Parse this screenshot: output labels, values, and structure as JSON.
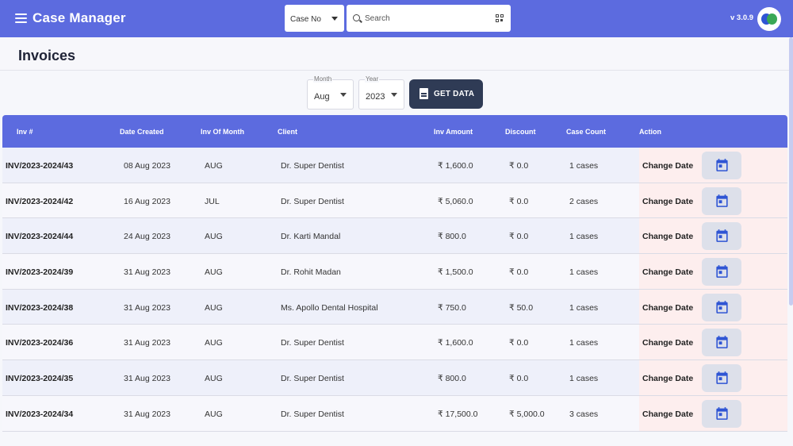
{
  "app": {
    "title": "Case Manager",
    "version": "v 3.0.9"
  },
  "search": {
    "type_label": "Case No",
    "placeholder": "Search"
  },
  "page": {
    "title": "Invoices"
  },
  "filters": {
    "month": {
      "label": "Month",
      "value": "Aug"
    },
    "year": {
      "label": "Year",
      "value": "2023"
    },
    "get_data_label": "GET DATA"
  },
  "table": {
    "headers": [
      "Inv #",
      "Date Created",
      "Inv Of Month",
      "Client",
      "Inv Amount",
      "Discount",
      "Case Count",
      "Action"
    ],
    "action_label": "Change Date",
    "rows": [
      {
        "inv": "INV/2023-2024/43",
        "date": "08 Aug 2023",
        "month": "AUG",
        "client": "Dr. Super Dentist",
        "amount": "₹ 1,600.0",
        "discount": "₹ 0.0",
        "cases": "1 cases"
      },
      {
        "inv": "INV/2023-2024/42",
        "date": "16 Aug 2023",
        "month": "JUL",
        "client": "Dr. Super Dentist",
        "amount": "₹ 5,060.0",
        "discount": "₹ 0.0",
        "cases": "2 cases"
      },
      {
        "inv": "INV/2023-2024/44",
        "date": "24 Aug 2023",
        "month": "AUG",
        "client": "Dr. Karti Mandal",
        "amount": "₹ 800.0",
        "discount": "₹ 0.0",
        "cases": "1 cases"
      },
      {
        "inv": "INV/2023-2024/39",
        "date": "31 Aug 2023",
        "month": "AUG",
        "client": "Dr. Rohit Madan",
        "amount": "₹ 1,500.0",
        "discount": "₹ 0.0",
        "cases": "1 cases"
      },
      {
        "inv": "INV/2023-2024/38",
        "date": "31 Aug 2023",
        "month": "AUG",
        "client": "Ms. Apollo Dental Hospital",
        "amount": "₹ 750.0",
        "discount": "₹ 50.0",
        "cases": "1 cases"
      },
      {
        "inv": "INV/2023-2024/36",
        "date": "31 Aug 2023",
        "month": "AUG",
        "client": "Dr. Super Dentist",
        "amount": "₹ 1,600.0",
        "discount": "₹ 0.0",
        "cases": "1 cases"
      },
      {
        "inv": "INV/2023-2024/35",
        "date": "31 Aug 2023",
        "month": "AUG",
        "client": "Dr. Super Dentist",
        "amount": "₹ 800.0",
        "discount": "₹ 0.0",
        "cases": "1 cases"
      },
      {
        "inv": "INV/2023-2024/34",
        "date": "31 Aug 2023",
        "month": "AUG",
        "client": "Dr. Super Dentist",
        "amount": "₹ 17,500.0",
        "discount": "₹ 5,000.0",
        "cases": "3 cases"
      }
    ]
  },
  "colors": {
    "primary": "#5c6bdf",
    "dark_button": "#2f3b55",
    "calendar_icon": "#2f55d4",
    "action_bg": "#fdeeee"
  }
}
